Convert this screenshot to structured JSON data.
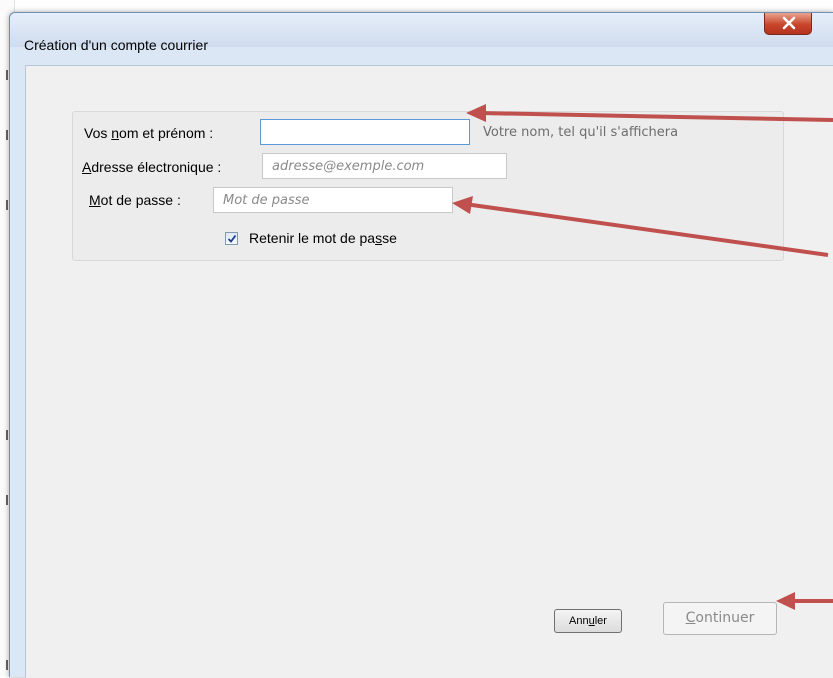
{
  "window": {
    "title": "Création d'un compte courrier"
  },
  "form": {
    "name": {
      "label_before": "Vos ",
      "label_accel": "n",
      "label_after": "om et prénom :",
      "value": "",
      "placeholder": "",
      "hint": "Votre nom, tel qu'il s'affichera"
    },
    "email": {
      "label_before": "",
      "label_accel": "A",
      "label_after": "dresse électronique :",
      "value": "",
      "placeholder": "adresse@exemple.com"
    },
    "password": {
      "label_before": "",
      "label_accel": "M",
      "label_after": "ot de passe :",
      "value": "",
      "placeholder": "Mot de passe"
    },
    "remember": {
      "label_before": "Retenir le mot de pa",
      "label_accel": "s",
      "label_after": "se",
      "checked": true
    }
  },
  "buttons": {
    "cancel": {
      "before": "Ann",
      "accel": "u",
      "after": "ler"
    },
    "continue": {
      "before": "",
      "accel": "C",
      "after": "ontinuer"
    }
  },
  "colors": {
    "arrow": "#c0504d",
    "close_button": "#c8452b",
    "focus_border": "#5b9bd5"
  }
}
